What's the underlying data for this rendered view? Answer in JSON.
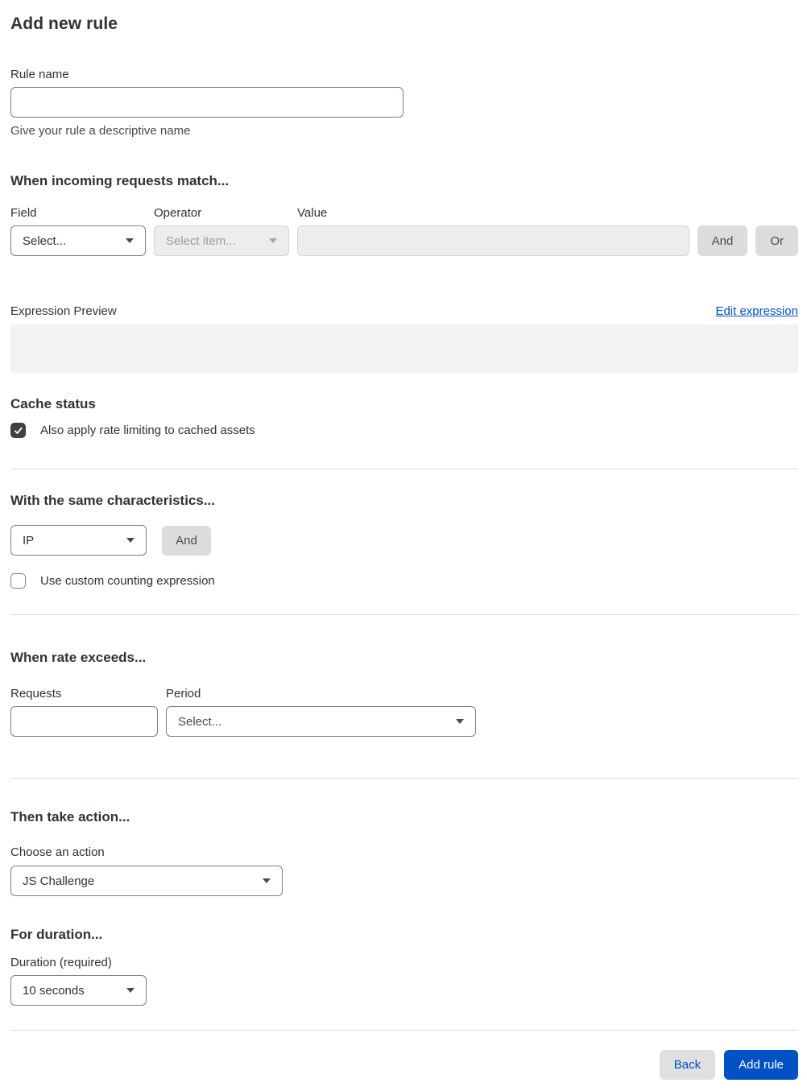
{
  "page": {
    "title": "Add new rule"
  },
  "rule_name": {
    "label": "Rule name",
    "value": "",
    "helper": "Give your rule a descriptive name"
  },
  "match": {
    "heading": "When incoming requests match...",
    "field": {
      "label": "Field",
      "selected": "Select..."
    },
    "operator": {
      "label": "Operator",
      "selected": "Select item...",
      "disabled": true
    },
    "value": {
      "label": "Value",
      "value": "",
      "disabled": true
    },
    "and_button": "And",
    "or_button": "Or"
  },
  "expression": {
    "label": "Expression Preview",
    "edit_link": "Edit expression",
    "content": ""
  },
  "cache": {
    "heading": "Cache status",
    "checkbox_label": "Also apply rate limiting to cached assets",
    "checked": true
  },
  "characteristics": {
    "heading": "With the same characteristics...",
    "selected": "IP",
    "and_button": "And",
    "checkbox_label": "Use custom counting expression",
    "checked": false
  },
  "rate": {
    "heading": "When rate exceeds...",
    "requests": {
      "label": "Requests",
      "value": ""
    },
    "period": {
      "label": "Period",
      "selected": "Select..."
    }
  },
  "action": {
    "heading": "Then take action...",
    "label": "Choose an action",
    "selected": "JS Challenge"
  },
  "duration": {
    "heading": "For duration...",
    "label": "Duration (required)",
    "selected": "10 seconds"
  },
  "footer": {
    "back_button": "Back",
    "submit_button": "Add rule"
  },
  "colors": {
    "accent_blue": "#0051c3",
    "button_gray": "#dcdcdc",
    "checkbox_checked": "#404040",
    "disabled_bg": "#ededed",
    "divider": "#d9d9d9",
    "text": "#313131"
  }
}
